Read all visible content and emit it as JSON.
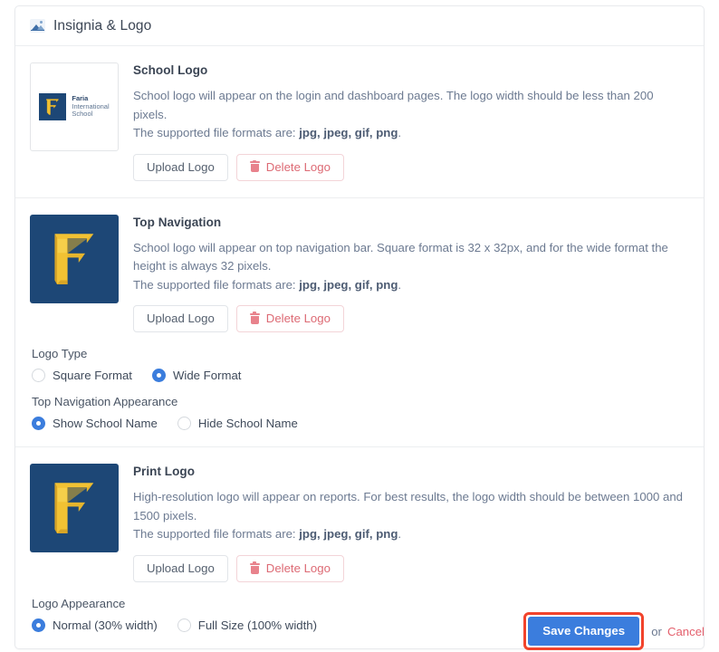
{
  "card": {
    "header": {
      "title": "Insignia & Logo",
      "icon": "image-mountain-icon"
    }
  },
  "sections": [
    {
      "id": "school-logo",
      "title": "School Logo",
      "desc_line1": "School logo will appear on the login and dashboard pages. The logo width should be less than 200 pixels.",
      "desc_line2_prefix": "The supported file formats are: ",
      "desc_formats": "jpg, jpeg, gif, png",
      "desc_line2_suffix": ".",
      "upload_label": "Upload Logo",
      "delete_label": "Delete Logo",
      "thumb_style": "framed-lockup",
      "logo": {
        "mark_letter": "F",
        "name_line1": "Faria",
        "name_line2": "International",
        "name_line3": "School"
      }
    },
    {
      "id": "top-navigation",
      "title": "Top Navigation",
      "desc_line1": "School logo will appear on top navigation bar. Square format is 32 x 32px, and for the wide format the height is always 32 pixels.",
      "desc_line2_prefix": "The supported file formats are: ",
      "desc_formats": "jpg, jpeg, gif, png",
      "desc_line2_suffix": ".",
      "upload_label": "Upload Logo",
      "delete_label": "Delete Logo",
      "thumb_style": "navy-mark",
      "logo": {
        "mark_letter": "F"
      },
      "options": [
        {
          "label": "Logo Type",
          "name": "logo-type",
          "choices": [
            {
              "label": "Square Format",
              "selected": false
            },
            {
              "label": "Wide Format",
              "selected": true
            }
          ]
        },
        {
          "label": "Top Navigation Appearance",
          "name": "top-nav-appearance",
          "choices": [
            {
              "label": "Show School Name",
              "selected": true
            },
            {
              "label": "Hide School Name",
              "selected": false
            }
          ]
        }
      ]
    },
    {
      "id": "print-logo",
      "title": "Print Logo",
      "desc_line1": "High-resolution logo will appear on reports. For best results, the logo width should be between 1000 and 1500 pixels.",
      "desc_line2_prefix": "The supported file formats are: ",
      "desc_formats": "jpg, jpeg, gif, png",
      "desc_line2_suffix": ".",
      "upload_label": "Upload Logo",
      "delete_label": "Delete Logo",
      "thumb_style": "navy-mark",
      "logo": {
        "mark_letter": "F"
      },
      "options": [
        {
          "label": "Logo Appearance",
          "name": "logo-appearance",
          "choices": [
            {
              "label": "Normal (30% width)",
              "selected": true
            },
            {
              "label": "Full Size (100% width)",
              "selected": false
            }
          ]
        }
      ]
    }
  ],
  "footer": {
    "save_label": "Save Changes",
    "or_label": "or",
    "cancel_label": "Cancel",
    "save_highlighted": true
  },
  "colors": {
    "primary": "#3b7ddd",
    "danger": "#e4606d",
    "highlight_ring": "#f2432b",
    "logo_navy": "#1d4776",
    "logo_gold": "#f0c033",
    "text": "#3b4554",
    "muted": "#6c7a91",
    "border": "#e8eaed"
  }
}
